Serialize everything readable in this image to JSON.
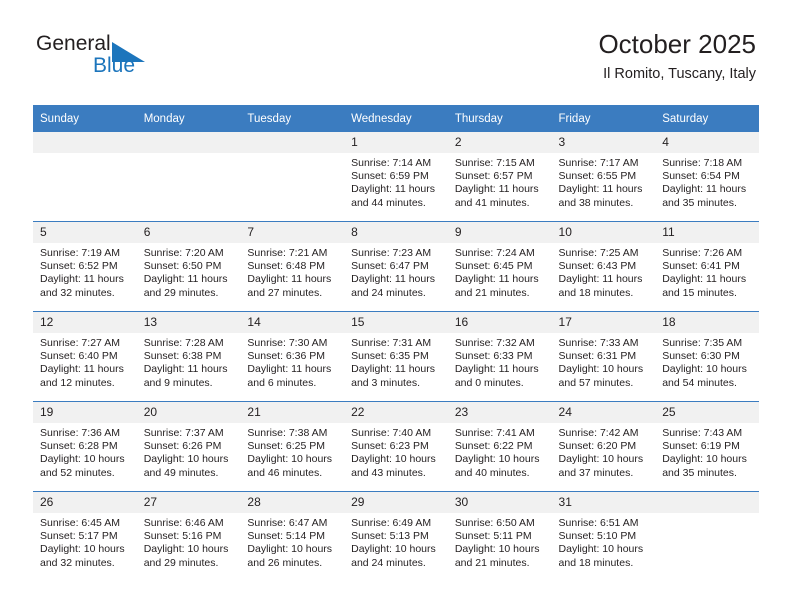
{
  "brand": {
    "word_one": "General",
    "word_two": "Blue",
    "accent_color": "#1c75bc",
    "triangle_icon": "triangle-icon"
  },
  "header": {
    "title": "October 2025",
    "subtitle": "Il Romito, Tuscany, Italy"
  },
  "calendar": {
    "header_bg": "#3b7cc0",
    "daynum_bg": "#f1f1f1",
    "weekday_headers": [
      "Sunday",
      "Monday",
      "Tuesday",
      "Wednesday",
      "Thursday",
      "Friday",
      "Saturday"
    ],
    "weeks": [
      [
        {
          "day": "",
          "empty": true,
          "sunrise": "",
          "sunset": "",
          "daylight_1": "",
          "daylight_2": ""
        },
        {
          "day": "",
          "empty": true,
          "sunrise": "",
          "sunset": "",
          "daylight_1": "",
          "daylight_2": ""
        },
        {
          "day": "",
          "empty": true,
          "sunrise": "",
          "sunset": "",
          "daylight_1": "",
          "daylight_2": ""
        },
        {
          "day": "1",
          "empty": false,
          "sunrise": "Sunrise: 7:14 AM",
          "sunset": "Sunset: 6:59 PM",
          "daylight_1": "Daylight: 11 hours",
          "daylight_2": "and 44 minutes."
        },
        {
          "day": "2",
          "empty": false,
          "sunrise": "Sunrise: 7:15 AM",
          "sunset": "Sunset: 6:57 PM",
          "daylight_1": "Daylight: 11 hours",
          "daylight_2": "and 41 minutes."
        },
        {
          "day": "3",
          "empty": false,
          "sunrise": "Sunrise: 7:17 AM",
          "sunset": "Sunset: 6:55 PM",
          "daylight_1": "Daylight: 11 hours",
          "daylight_2": "and 38 minutes."
        },
        {
          "day": "4",
          "empty": false,
          "sunrise": "Sunrise: 7:18 AM",
          "sunset": "Sunset: 6:54 PM",
          "daylight_1": "Daylight: 11 hours",
          "daylight_2": "and 35 minutes."
        }
      ],
      [
        {
          "day": "5",
          "empty": false,
          "sunrise": "Sunrise: 7:19 AM",
          "sunset": "Sunset: 6:52 PM",
          "daylight_1": "Daylight: 11 hours",
          "daylight_2": "and 32 minutes."
        },
        {
          "day": "6",
          "empty": false,
          "sunrise": "Sunrise: 7:20 AM",
          "sunset": "Sunset: 6:50 PM",
          "daylight_1": "Daylight: 11 hours",
          "daylight_2": "and 29 minutes."
        },
        {
          "day": "7",
          "empty": false,
          "sunrise": "Sunrise: 7:21 AM",
          "sunset": "Sunset: 6:48 PM",
          "daylight_1": "Daylight: 11 hours",
          "daylight_2": "and 27 minutes."
        },
        {
          "day": "8",
          "empty": false,
          "sunrise": "Sunrise: 7:23 AM",
          "sunset": "Sunset: 6:47 PM",
          "daylight_1": "Daylight: 11 hours",
          "daylight_2": "and 24 minutes."
        },
        {
          "day": "9",
          "empty": false,
          "sunrise": "Sunrise: 7:24 AM",
          "sunset": "Sunset: 6:45 PM",
          "daylight_1": "Daylight: 11 hours",
          "daylight_2": "and 21 minutes."
        },
        {
          "day": "10",
          "empty": false,
          "sunrise": "Sunrise: 7:25 AM",
          "sunset": "Sunset: 6:43 PM",
          "daylight_1": "Daylight: 11 hours",
          "daylight_2": "and 18 minutes."
        },
        {
          "day": "11",
          "empty": false,
          "sunrise": "Sunrise: 7:26 AM",
          "sunset": "Sunset: 6:41 PM",
          "daylight_1": "Daylight: 11 hours",
          "daylight_2": "and 15 minutes."
        }
      ],
      [
        {
          "day": "12",
          "empty": false,
          "sunrise": "Sunrise: 7:27 AM",
          "sunset": "Sunset: 6:40 PM",
          "daylight_1": "Daylight: 11 hours",
          "daylight_2": "and 12 minutes."
        },
        {
          "day": "13",
          "empty": false,
          "sunrise": "Sunrise: 7:28 AM",
          "sunset": "Sunset: 6:38 PM",
          "daylight_1": "Daylight: 11 hours",
          "daylight_2": "and 9 minutes."
        },
        {
          "day": "14",
          "empty": false,
          "sunrise": "Sunrise: 7:30 AM",
          "sunset": "Sunset: 6:36 PM",
          "daylight_1": "Daylight: 11 hours",
          "daylight_2": "and 6 minutes."
        },
        {
          "day": "15",
          "empty": false,
          "sunrise": "Sunrise: 7:31 AM",
          "sunset": "Sunset: 6:35 PM",
          "daylight_1": "Daylight: 11 hours",
          "daylight_2": "and 3 minutes."
        },
        {
          "day": "16",
          "empty": false,
          "sunrise": "Sunrise: 7:32 AM",
          "sunset": "Sunset: 6:33 PM",
          "daylight_1": "Daylight: 11 hours",
          "daylight_2": "and 0 minutes."
        },
        {
          "day": "17",
          "empty": false,
          "sunrise": "Sunrise: 7:33 AM",
          "sunset": "Sunset: 6:31 PM",
          "daylight_1": "Daylight: 10 hours",
          "daylight_2": "and 57 minutes."
        },
        {
          "day": "18",
          "empty": false,
          "sunrise": "Sunrise: 7:35 AM",
          "sunset": "Sunset: 6:30 PM",
          "daylight_1": "Daylight: 10 hours",
          "daylight_2": "and 54 minutes."
        }
      ],
      [
        {
          "day": "19",
          "empty": false,
          "sunrise": "Sunrise: 7:36 AM",
          "sunset": "Sunset: 6:28 PM",
          "daylight_1": "Daylight: 10 hours",
          "daylight_2": "and 52 minutes."
        },
        {
          "day": "20",
          "empty": false,
          "sunrise": "Sunrise: 7:37 AM",
          "sunset": "Sunset: 6:26 PM",
          "daylight_1": "Daylight: 10 hours",
          "daylight_2": "and 49 minutes."
        },
        {
          "day": "21",
          "empty": false,
          "sunrise": "Sunrise: 7:38 AM",
          "sunset": "Sunset: 6:25 PM",
          "daylight_1": "Daylight: 10 hours",
          "daylight_2": "and 46 minutes."
        },
        {
          "day": "22",
          "empty": false,
          "sunrise": "Sunrise: 7:40 AM",
          "sunset": "Sunset: 6:23 PM",
          "daylight_1": "Daylight: 10 hours",
          "daylight_2": "and 43 minutes."
        },
        {
          "day": "23",
          "empty": false,
          "sunrise": "Sunrise: 7:41 AM",
          "sunset": "Sunset: 6:22 PM",
          "daylight_1": "Daylight: 10 hours",
          "daylight_2": "and 40 minutes."
        },
        {
          "day": "24",
          "empty": false,
          "sunrise": "Sunrise: 7:42 AM",
          "sunset": "Sunset: 6:20 PM",
          "daylight_1": "Daylight: 10 hours",
          "daylight_2": "and 37 minutes."
        },
        {
          "day": "25",
          "empty": false,
          "sunrise": "Sunrise: 7:43 AM",
          "sunset": "Sunset: 6:19 PM",
          "daylight_1": "Daylight: 10 hours",
          "daylight_2": "and 35 minutes."
        }
      ],
      [
        {
          "day": "26",
          "empty": false,
          "sunrise": "Sunrise: 6:45 AM",
          "sunset": "Sunset: 5:17 PM",
          "daylight_1": "Daylight: 10 hours",
          "daylight_2": "and 32 minutes."
        },
        {
          "day": "27",
          "empty": false,
          "sunrise": "Sunrise: 6:46 AM",
          "sunset": "Sunset: 5:16 PM",
          "daylight_1": "Daylight: 10 hours",
          "daylight_2": "and 29 minutes."
        },
        {
          "day": "28",
          "empty": false,
          "sunrise": "Sunrise: 6:47 AM",
          "sunset": "Sunset: 5:14 PM",
          "daylight_1": "Daylight: 10 hours",
          "daylight_2": "and 26 minutes."
        },
        {
          "day": "29",
          "empty": false,
          "sunrise": "Sunrise: 6:49 AM",
          "sunset": "Sunset: 5:13 PM",
          "daylight_1": "Daylight: 10 hours",
          "daylight_2": "and 24 minutes."
        },
        {
          "day": "30",
          "empty": false,
          "sunrise": "Sunrise: 6:50 AM",
          "sunset": "Sunset: 5:11 PM",
          "daylight_1": "Daylight: 10 hours",
          "daylight_2": "and 21 minutes."
        },
        {
          "day": "31",
          "empty": false,
          "sunrise": "Sunrise: 6:51 AM",
          "sunset": "Sunset: 5:10 PM",
          "daylight_1": "Daylight: 10 hours",
          "daylight_2": "and 18 minutes."
        },
        {
          "day": "",
          "empty": true,
          "sunrise": "",
          "sunset": "",
          "daylight_1": "",
          "daylight_2": ""
        }
      ]
    ]
  }
}
